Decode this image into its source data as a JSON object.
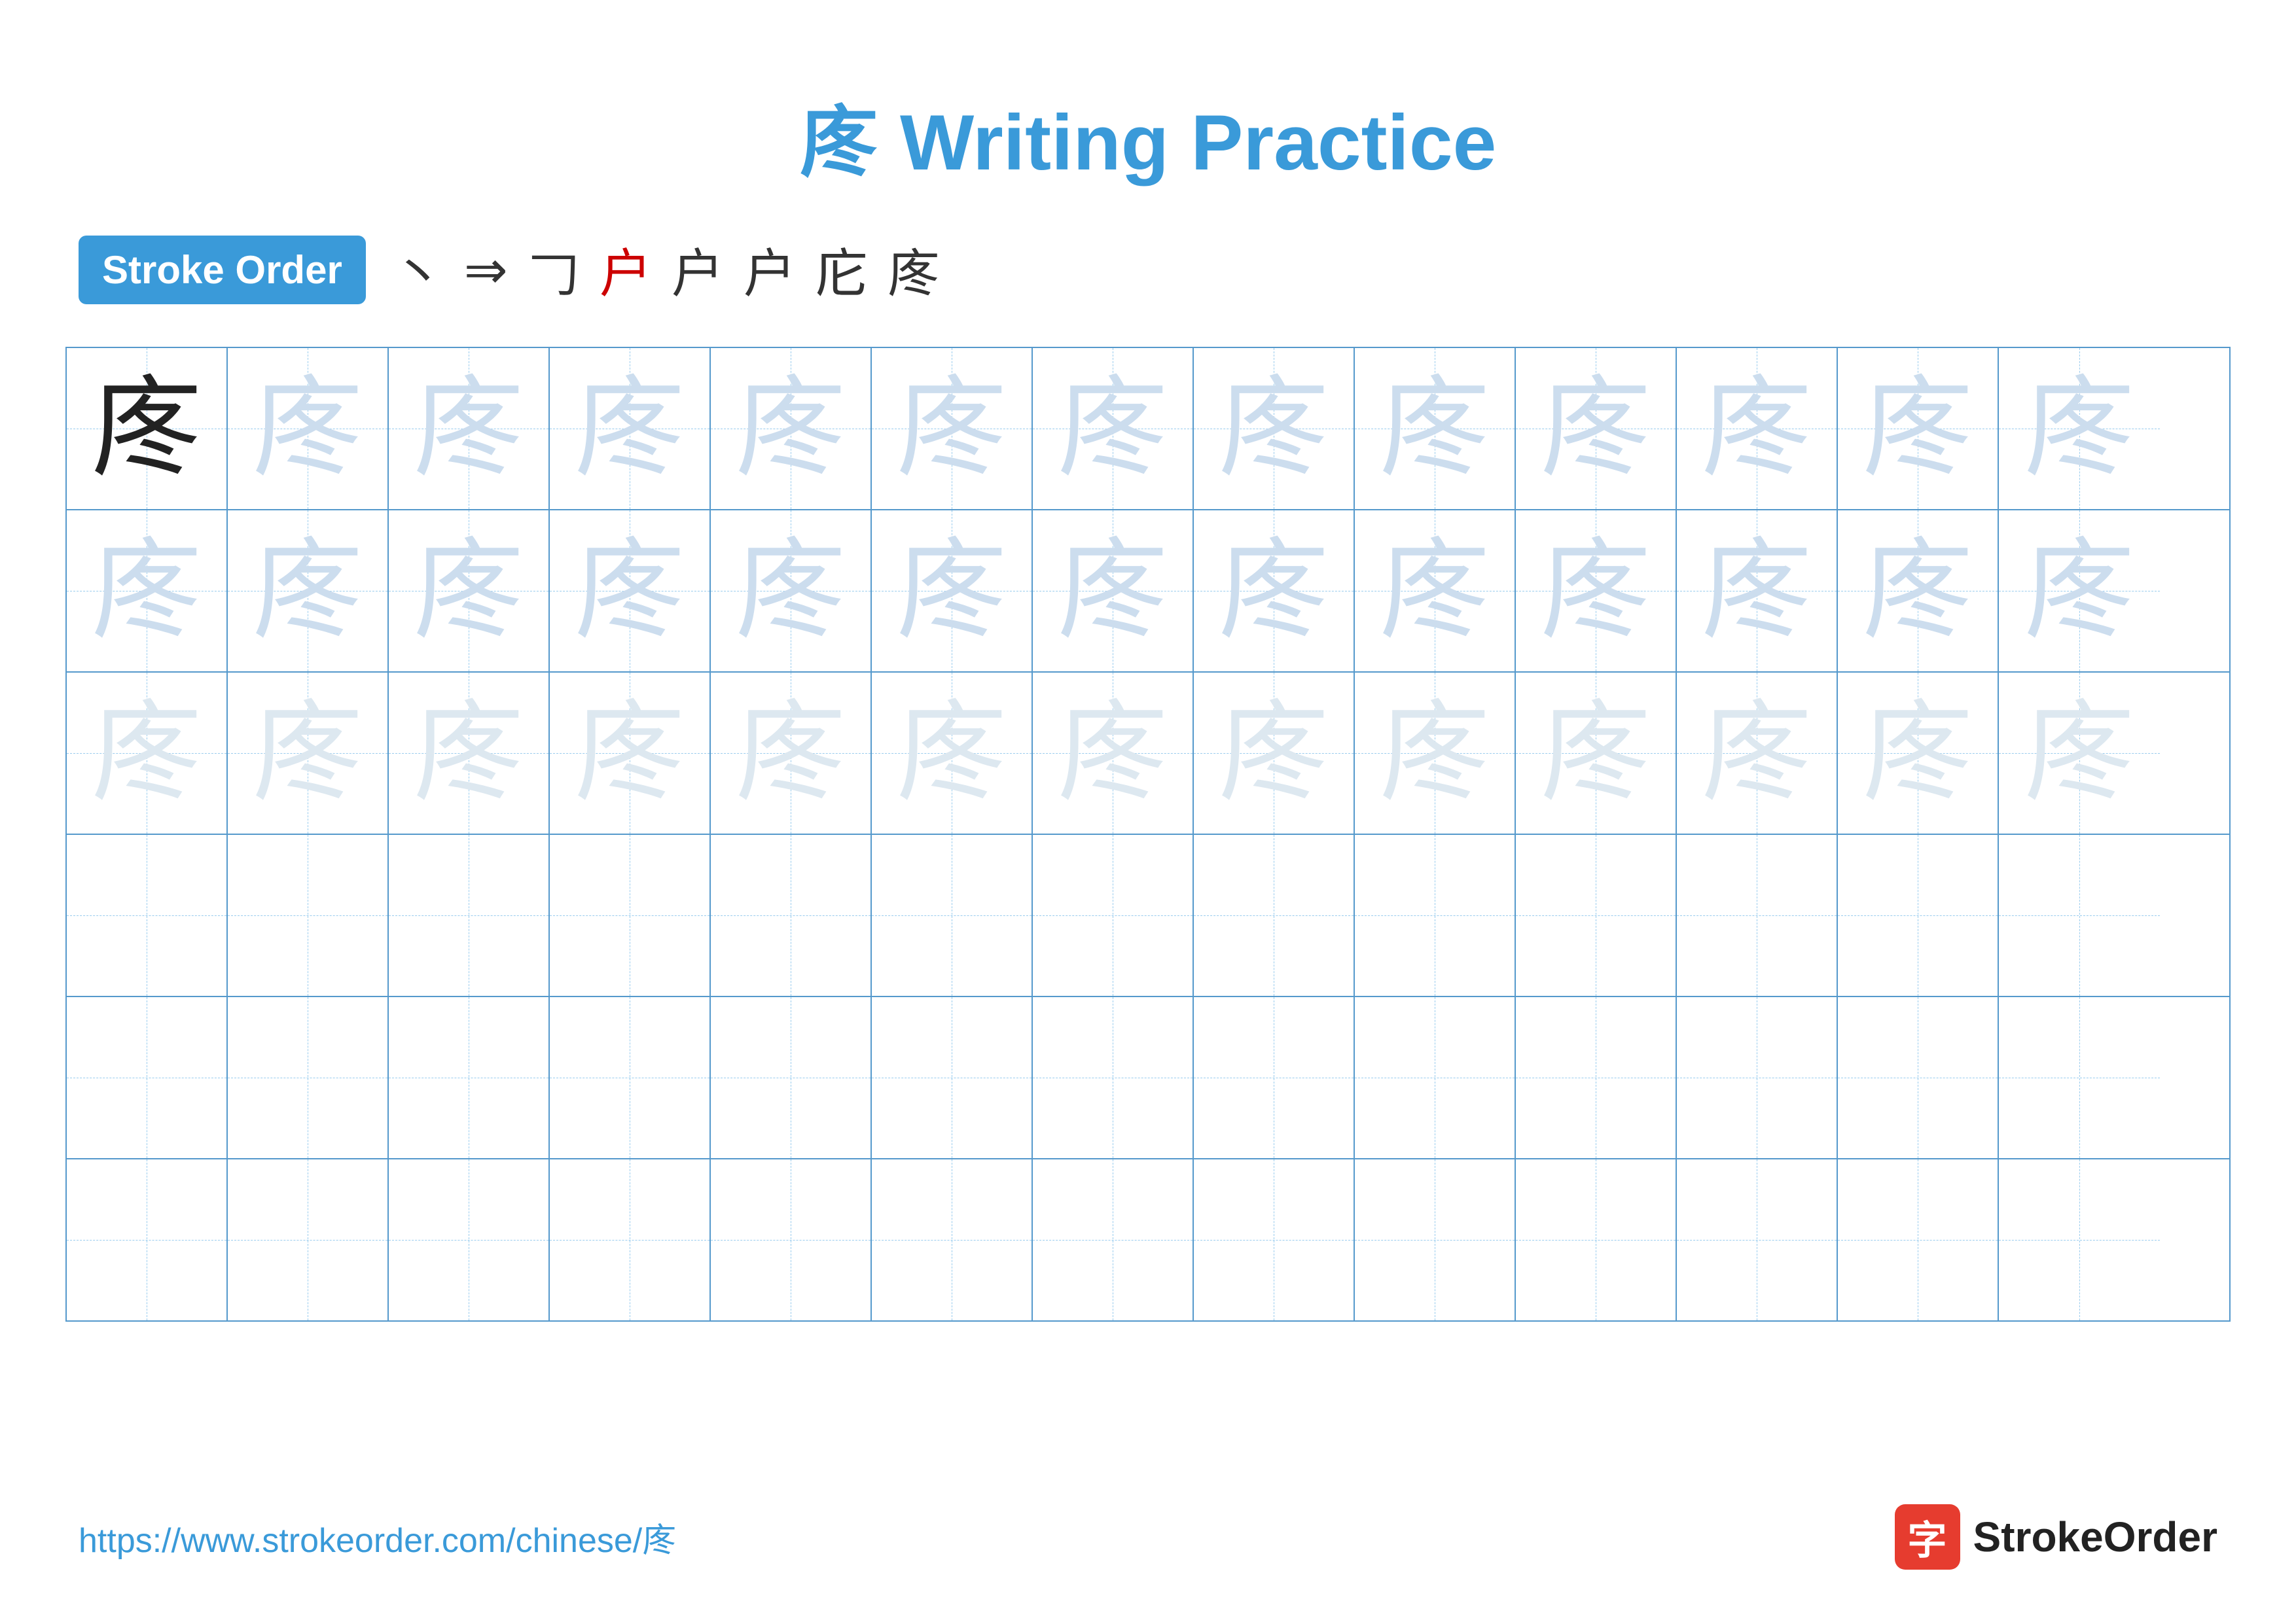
{
  "title": {
    "char": "庝",
    "text": " Writing Practice",
    "full": "庝 Writing Practice"
  },
  "stroke_order": {
    "badge_label": "Stroke Order",
    "strokes": [
      {
        "char": "丶",
        "red": false
      },
      {
        "char": "→",
        "red": false
      },
      {
        "char": "𠃌",
        "red": false
      },
      {
        "char": "户",
        "red": true
      },
      {
        "char": "户",
        "red": false
      },
      {
        "char": "户",
        "red": false
      },
      {
        "char": "庀",
        "red": false
      },
      {
        "char": "庝",
        "red": false
      }
    ]
  },
  "grid": {
    "rows": 6,
    "cols": 13,
    "char": "庝",
    "filled_rows": [
      {
        "type": "dark_then_light",
        "dark_count": 1,
        "total": 13
      },
      {
        "type": "light_only",
        "total": 13
      },
      {
        "type": "lighter",
        "total": 13
      },
      {
        "type": "empty",
        "total": 13
      },
      {
        "type": "empty",
        "total": 13
      },
      {
        "type": "empty",
        "total": 13
      }
    ]
  },
  "footer": {
    "url": "https://www.strokeorder.com/chinese/庝",
    "logo_text": "StrokeOrder",
    "logo_char": "字"
  }
}
